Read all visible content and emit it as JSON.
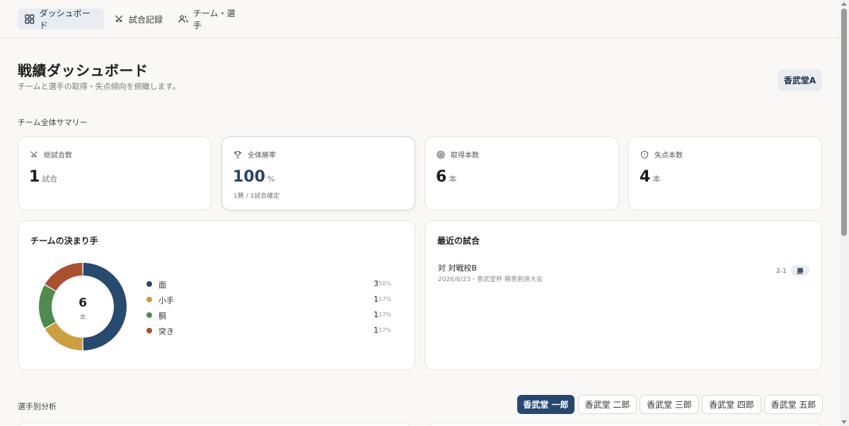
{
  "nav": {
    "items": [
      {
        "label": "ダッシュボード",
        "icon": "dashboard-grid-icon",
        "active": true
      },
      {
        "label": "試合記録",
        "icon": "crossed-swords-icon",
        "active": false
      },
      {
        "label": "チーム・選手",
        "icon": "users-icon",
        "active": false
      }
    ]
  },
  "header": {
    "title": "戦績ダッシュボード",
    "subtitle": "チームと選手の取得・失点傾向を俯瞰します。",
    "team_badge": "香武堂A"
  },
  "summary": {
    "section_label": "チーム全体サマリー",
    "cards": [
      {
        "label": "総試合数",
        "icon": "crossed-swords-icon",
        "value": "1",
        "unit": "試合",
        "note": ""
      },
      {
        "label": "全体勝率",
        "icon": "trophy-icon",
        "value": "100",
        "unit": "%",
        "note": "1勝 / 1試合確定"
      },
      {
        "label": "取得本数",
        "icon": "target-icon",
        "value": "6",
        "unit": "本",
        "note": ""
      },
      {
        "label": "失点本数",
        "icon": "shield-icon",
        "value": "4",
        "unit": "本",
        "note": ""
      }
    ]
  },
  "techniques": {
    "title": "チームの決まり手",
    "total": "6",
    "total_unit": "本",
    "items": [
      {
        "label": "面",
        "count": 3,
        "pct": "50%",
        "color": "#284a6e"
      },
      {
        "label": "小手",
        "count": 1,
        "pct": "17%",
        "color": "#cc9e3f"
      },
      {
        "label": "胴",
        "count": 1,
        "pct": "17%",
        "color": "#4f8a4f"
      },
      {
        "label": "突き",
        "count": 1,
        "pct": "17%",
        "color": "#a9512e"
      }
    ]
  },
  "recent": {
    "title": "最近の試合",
    "matches": [
      {
        "opponent": "対 対戦校B",
        "meta": "2026/6/23・香武堂杯 親善剣道大会",
        "score": "2-1",
        "result": "勝"
      }
    ]
  },
  "players": {
    "section_label": "選手別分析",
    "tabs": [
      {
        "label": "香武堂 一郎",
        "active": true
      },
      {
        "label": "香武堂 二郎",
        "active": false
      },
      {
        "label": "香武堂 三郎",
        "active": false
      },
      {
        "label": "香武堂 四郎",
        "active": false
      },
      {
        "label": "香武堂 五郎",
        "active": false
      }
    ]
  },
  "colors": {
    "accent": "#26476f",
    "badge_bg": "#e9ecf1",
    "page_bg": "#f9f8f6"
  }
}
